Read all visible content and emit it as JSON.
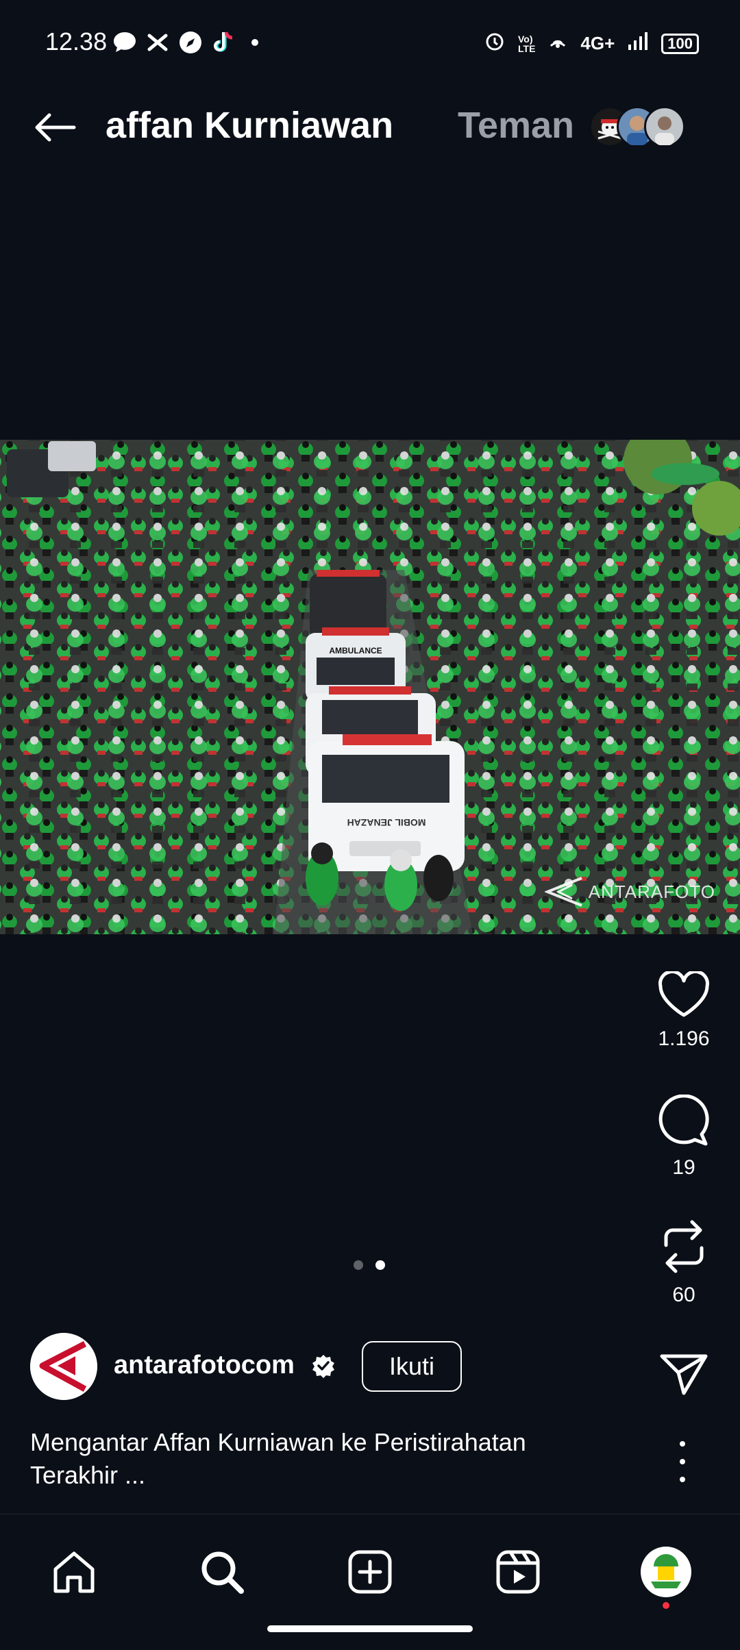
{
  "status_bar": {
    "time": "12.38",
    "right_icons": [
      "alarm-icon",
      "volte-icon",
      "hotspot-icon",
      "signal-icon"
    ],
    "network": "4G+",
    "battery": "100"
  },
  "header": {
    "back_icon": "arrow-left-icon",
    "title": "affan Kurniawan",
    "tab": "Teman"
  },
  "media": {
    "watermark": "ANTARAFOTO",
    "page_dots": 2,
    "active_dot": 2
  },
  "actions": {
    "likes": "1.196",
    "comments": "19",
    "reposts": "60"
  },
  "post": {
    "username": "antarafotocom",
    "verified": true,
    "follow_label": "Ikuti",
    "caption": "Mengantar Affan Kurniawan ke Peristirahatan Terakhir ..."
  },
  "nav": {
    "items": [
      "home-icon",
      "search-icon",
      "create-icon",
      "reels-icon",
      "profile-avatar"
    ]
  },
  "colors": {
    "background": "#0b0f17",
    "muted": "#9aa0a6",
    "notification": "#ff3040",
    "antara_red": "#c8102e"
  }
}
